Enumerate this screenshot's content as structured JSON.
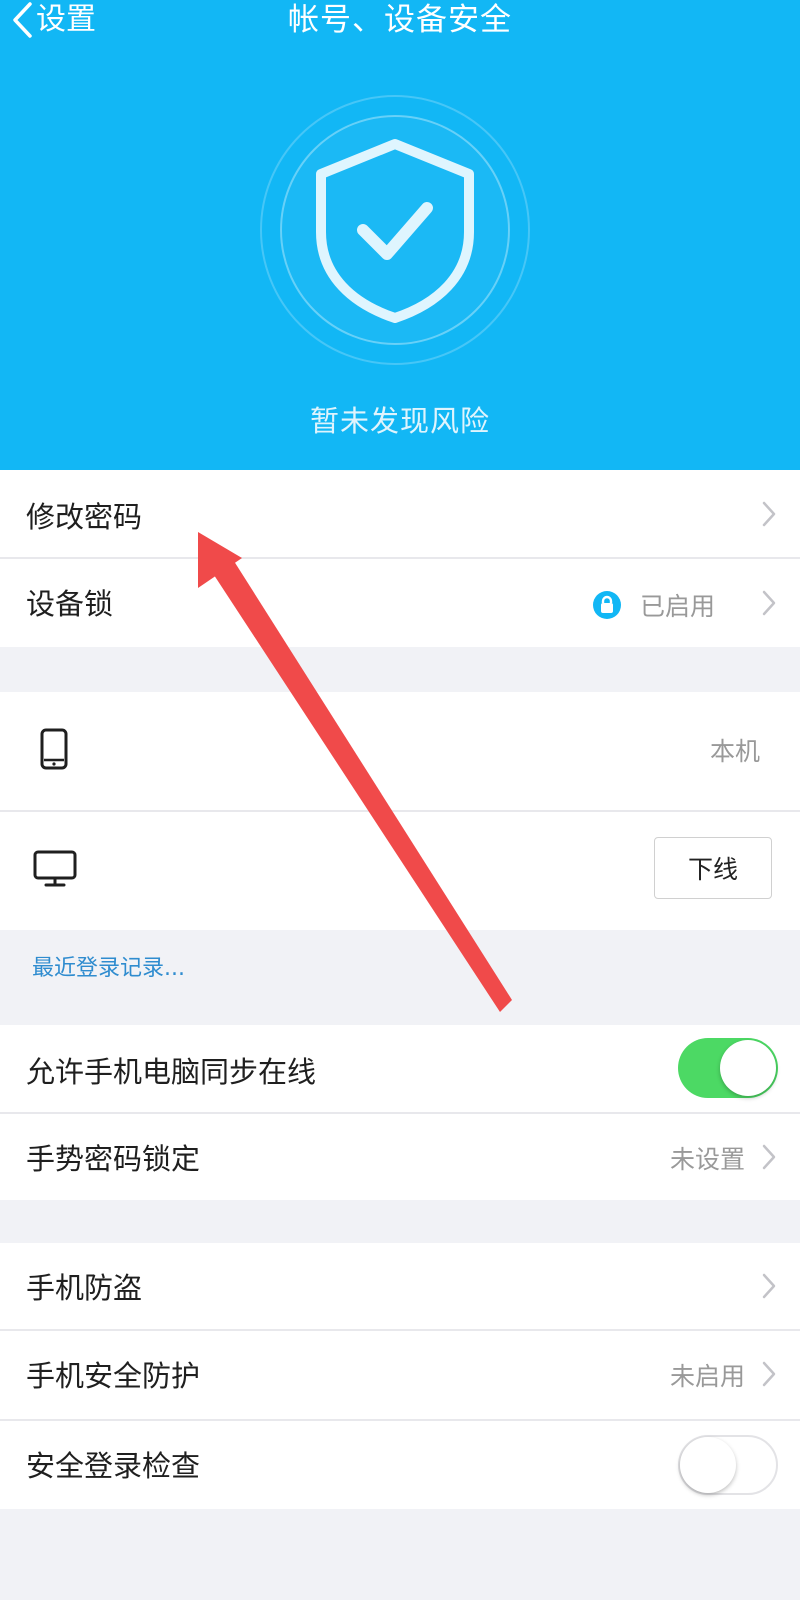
{
  "nav": {
    "back_label": "设置",
    "title": "帐号、设备安全"
  },
  "status": {
    "text": "暂未发现风险"
  },
  "rows": {
    "change_password": {
      "label": "修改密码"
    },
    "device_lock": {
      "label": "设备锁",
      "value": "已启用"
    },
    "this_device": {
      "value": "本机"
    },
    "pc_device": {
      "button": "下线"
    },
    "recent_login_link": "最近登录记录...",
    "sync_online": {
      "label": "允许手机电脑同步在线",
      "toggle": "on"
    },
    "gesture_lock": {
      "label": "手势密码锁定",
      "value": "未设置"
    },
    "anti_theft": {
      "label": "手机防盗"
    },
    "security_protect": {
      "label": "手机安全防护",
      "value": "未启用"
    },
    "login_check": {
      "label": "安全登录检查",
      "toggle": "off"
    }
  },
  "colors": {
    "header": "#12b7f5",
    "toggle_on": "#4cd964",
    "link": "#2f8ccf",
    "annotation_arrow": "#f04a4a"
  },
  "icons": {
    "shield": "shield-check-icon",
    "lock": "lock-icon",
    "phone": "phone-icon",
    "monitor": "monitor-icon",
    "chevron": "chevron-right-icon",
    "back": "chevron-left-icon"
  }
}
